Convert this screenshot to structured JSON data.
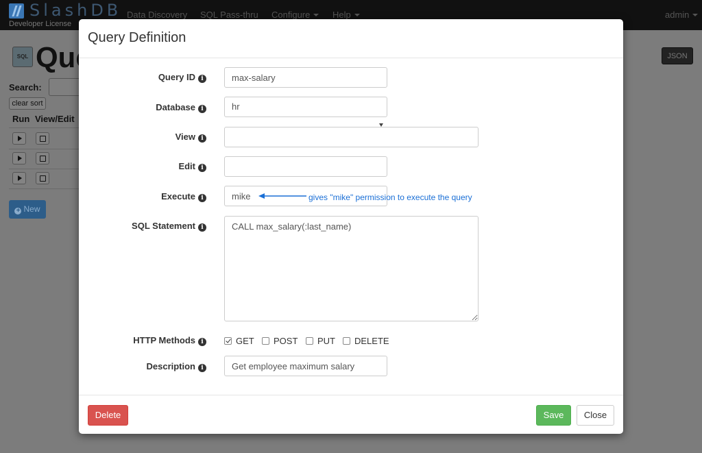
{
  "navbar": {
    "brand": "SlashDB",
    "license": "Developer License",
    "links": [
      "Data Discovery",
      "SQL Pass-thru",
      "Configure",
      "Help"
    ],
    "user": "admin"
  },
  "background": {
    "page_icon_text": "SQL",
    "page_title": "Que",
    "json_button": "JSON",
    "search_label": "Search:",
    "clear_sort": "clear sort",
    "columns": [
      "Run",
      "View/Edit"
    ],
    "new_button": "New"
  },
  "modal": {
    "title": "Query Definition",
    "fields": {
      "query_id": {
        "label": "Query ID",
        "value": "max-salary"
      },
      "database": {
        "label": "Database",
        "value": "hr"
      },
      "view": {
        "label": "View",
        "value": ""
      },
      "edit": {
        "label": "Edit",
        "value": ""
      },
      "execute": {
        "label": "Execute",
        "value": "mike"
      },
      "sql": {
        "label": "SQL Statement",
        "value": "CALL max_salary(:last_name)"
      },
      "http_methods": {
        "label": "HTTP Methods"
      },
      "description": {
        "label": "Description",
        "value": "Get employee maximum salary"
      }
    },
    "http_methods": [
      {
        "name": "GET",
        "checked": true
      },
      {
        "name": "POST",
        "checked": false
      },
      {
        "name": "PUT",
        "checked": false
      },
      {
        "name": "DELETE",
        "checked": false
      }
    ],
    "annotation": "gives \"mike\" permission to execute the query",
    "buttons": {
      "delete": "Delete",
      "save": "Save",
      "close": "Close"
    }
  },
  "colors": {
    "annotation": "#1a6fd6",
    "delete": "#d9534f",
    "save": "#5cb85c",
    "backdrop": "#7c7c7c"
  }
}
